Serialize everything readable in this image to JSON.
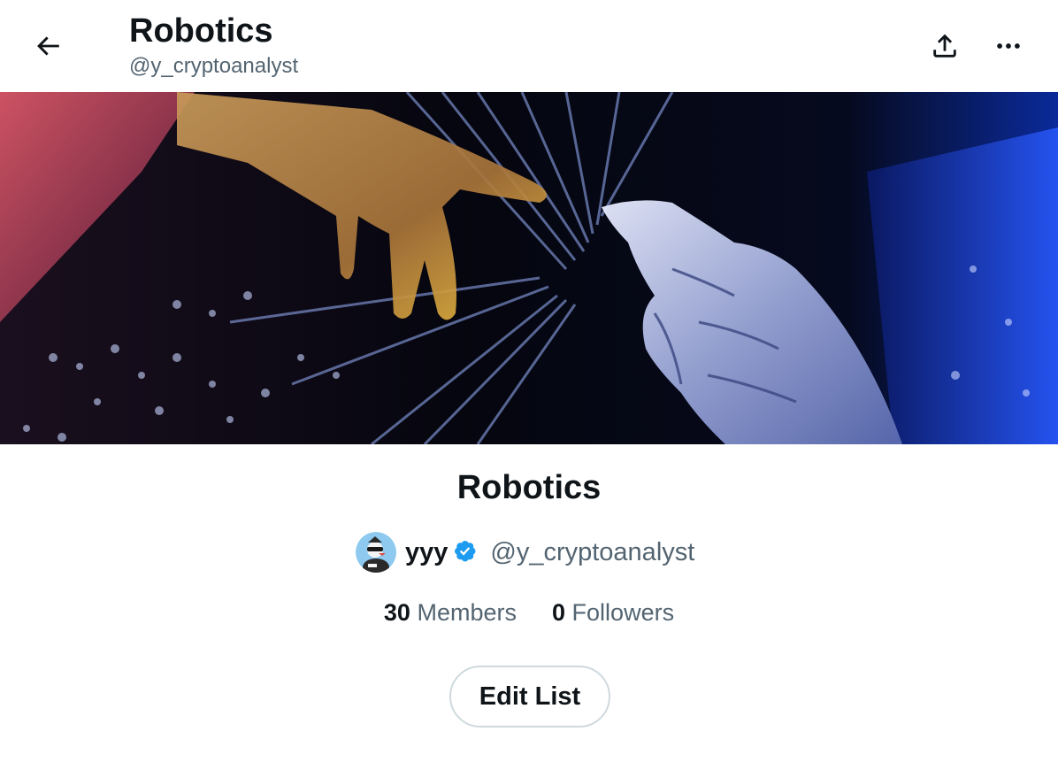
{
  "header": {
    "title": "Robotics",
    "handle": "@y_cryptoanalyst",
    "icons": {
      "back": "back-arrow-icon",
      "share": "share-icon",
      "more": "more-icon"
    }
  },
  "banner": {
    "alt": "human hand reaching toward robot hand"
  },
  "list": {
    "name": "Robotics",
    "owner": {
      "name": "yyy",
      "handle": "@y_cryptoanalyst",
      "verified": true
    },
    "stats": {
      "members_count": "30",
      "members_label": "Members",
      "followers_count": "0",
      "followers_label": "Followers"
    },
    "edit_label": "Edit List"
  },
  "colors": {
    "text": "#0f1419",
    "secondary": "#536471",
    "verified": "#1d9bf0",
    "border": "#cfd9de"
  }
}
